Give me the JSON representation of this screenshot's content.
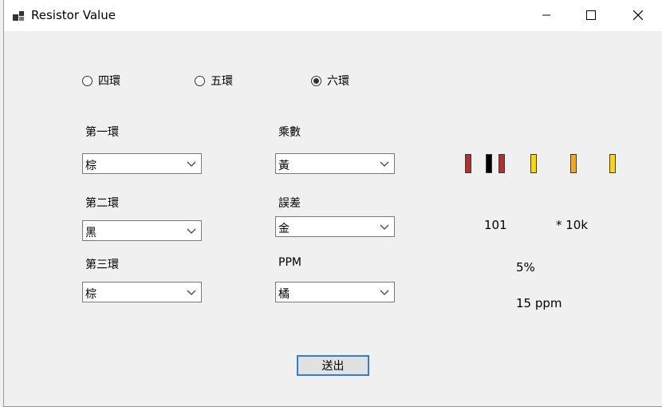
{
  "window": {
    "title": "Resistor Value"
  },
  "modes": [
    {
      "label": "四環",
      "selected": false
    },
    {
      "label": "五環",
      "selected": false
    },
    {
      "label": "六環",
      "selected": true
    }
  ],
  "fields": {
    "band1": {
      "label": "第一環",
      "value": "棕"
    },
    "band2": {
      "label": "第二環",
      "value": "黑"
    },
    "band3": {
      "label": "第三環",
      "value": "棕"
    },
    "multiplier": {
      "label": "乘數",
      "value": "黃"
    },
    "tolerance": {
      "label": "誤差",
      "value": "金"
    },
    "ppm": {
      "label": "PPM",
      "value": "橘"
    }
  },
  "preview": {
    "band_colors": [
      "#b23030",
      "#000000",
      "#b23030",
      "#ffd700",
      "#f5a623",
      "#ffd700"
    ]
  },
  "result": {
    "digits": "101",
    "multiplier": "* 10k",
    "tolerance": "5%",
    "ppm": "15 ppm"
  },
  "submit_label": "送出"
}
